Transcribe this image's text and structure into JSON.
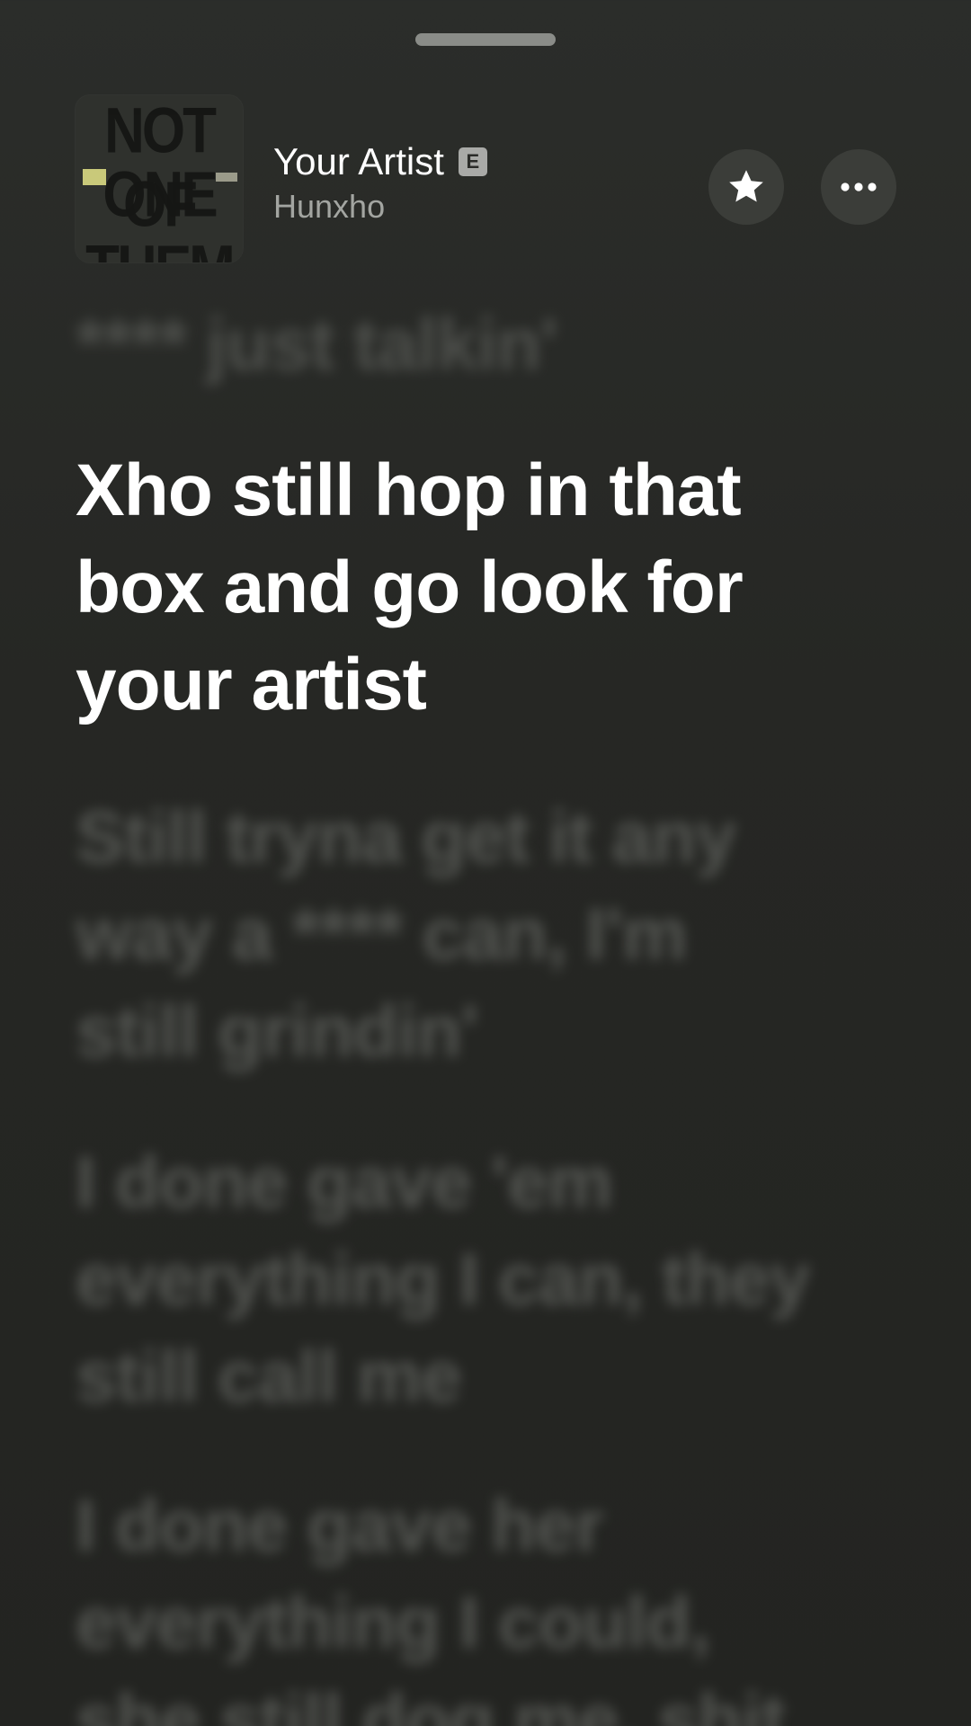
{
  "header": {
    "track_title": "Your Artist",
    "explicit_badge": "E",
    "artist": "Hunxho",
    "artwork_text": [
      "NOT ONE",
      "OF THEM"
    ]
  },
  "buttons": {
    "favorite_icon": "star-icon",
    "more_icon": "ellipsis-icon"
  },
  "lyrics": {
    "previous": "**** just talkin'",
    "current": "Xho still hop in that box and go look for your artist",
    "upcoming": [
      "Still tryna get it any way a **** can, I'm still grindin'",
      "I done gave 'em everything I can, they still call me",
      "I done gave her everything I could, she still dog me, shit"
    ]
  },
  "colors": {
    "background": "#262724",
    "active_lyric": "#ffffff",
    "inactive_lyric": "#5e605c",
    "button_bg": "#3b3d39"
  }
}
